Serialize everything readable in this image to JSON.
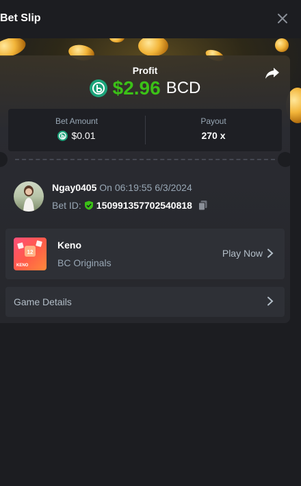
{
  "header": {
    "title": "Bet Slip"
  },
  "profit": {
    "label": "Profit",
    "amount": "$2.96",
    "currency": "BCD"
  },
  "stats": {
    "bet_amount_label": "Bet Amount",
    "bet_amount_value": "$0.01",
    "payout_label": "Payout",
    "payout_value": "270 x"
  },
  "user": {
    "name": "Ngay0405",
    "timestamp": "On 06:19:55 6/3/2024",
    "bet_id_label": "Bet ID:",
    "bet_id": "150991357702540818"
  },
  "game": {
    "name": "Keno",
    "provider": "BC Originals",
    "play_label": "Play Now",
    "thumb_number": "12",
    "thumb_text": "KENO"
  },
  "details": {
    "label": "Game Details"
  },
  "colors": {
    "profit_green": "#3bc117",
    "bcd_teal": "#1ca37a",
    "card": "#26272c",
    "background": "#1c1d21"
  },
  "icons": [
    "close-icon",
    "share-icon",
    "bcd-coin-icon",
    "verified-shield-icon",
    "copy-icon",
    "chevron-right-icon"
  ]
}
